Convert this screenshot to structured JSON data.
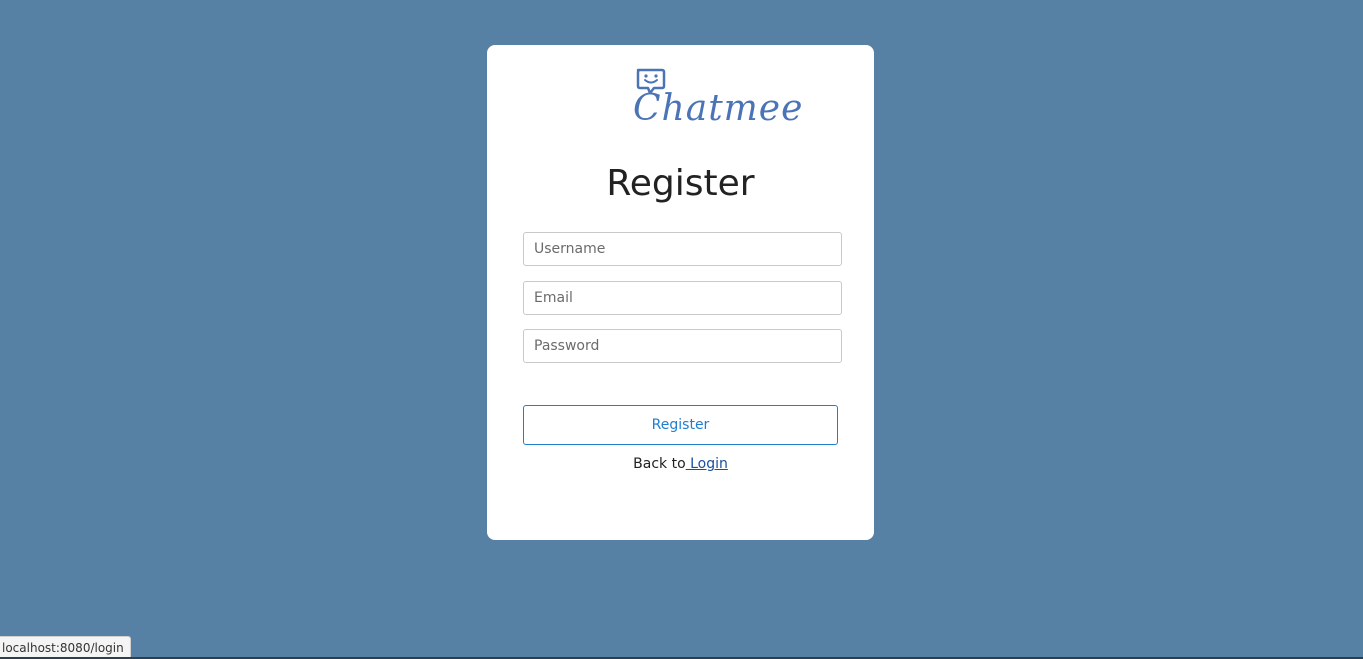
{
  "brand": {
    "name": "Chatmee",
    "logo_icon": "chat-bubble-smile-icon",
    "color": "#4a74b6"
  },
  "page": {
    "background": "#5681a4"
  },
  "form": {
    "title": "Register",
    "username_placeholder": "Username",
    "email_placeholder": "Email",
    "password_placeholder": "Password",
    "submit_label": "Register",
    "accent_color": "#1e7fd0"
  },
  "footer": {
    "back_text": "Back to",
    "login_link": " Login"
  },
  "status_bar": {
    "url": "localhost:8080/login"
  }
}
